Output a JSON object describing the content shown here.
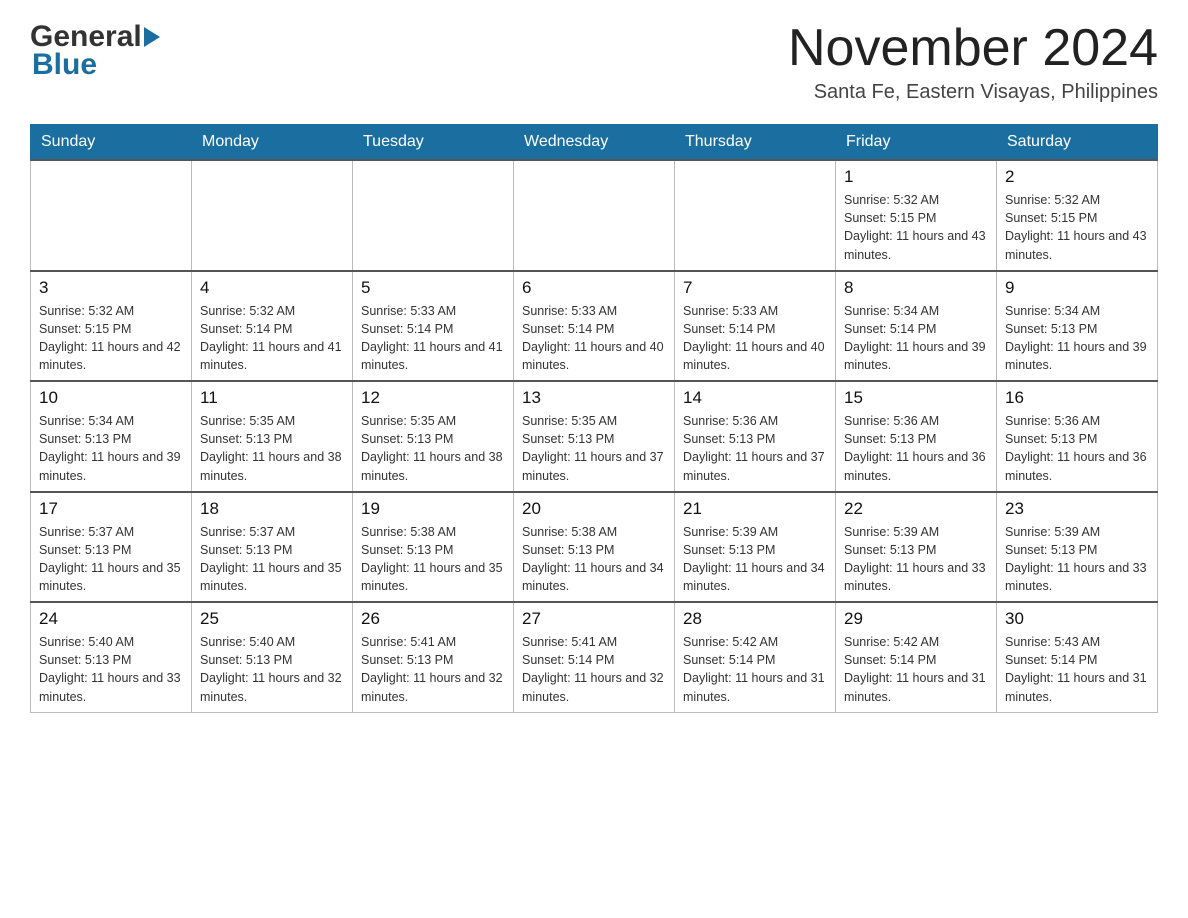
{
  "logo": {
    "general_text": "General",
    "blue_text": "Blue"
  },
  "header": {
    "month_year": "November 2024",
    "location": "Santa Fe, Eastern Visayas, Philippines"
  },
  "weekdays": [
    "Sunday",
    "Monday",
    "Tuesday",
    "Wednesday",
    "Thursday",
    "Friday",
    "Saturday"
  ],
  "weeks": [
    {
      "days": [
        {
          "number": "",
          "info": "",
          "empty": true
        },
        {
          "number": "",
          "info": "",
          "empty": true
        },
        {
          "number": "",
          "info": "",
          "empty": true
        },
        {
          "number": "",
          "info": "",
          "empty": true
        },
        {
          "number": "",
          "info": "",
          "empty": true
        },
        {
          "number": "1",
          "info": "Sunrise: 5:32 AM\nSunset: 5:15 PM\nDaylight: 11 hours and 43 minutes."
        },
        {
          "number": "2",
          "info": "Sunrise: 5:32 AM\nSunset: 5:15 PM\nDaylight: 11 hours and 43 minutes."
        }
      ]
    },
    {
      "days": [
        {
          "number": "3",
          "info": "Sunrise: 5:32 AM\nSunset: 5:15 PM\nDaylight: 11 hours and 42 minutes."
        },
        {
          "number": "4",
          "info": "Sunrise: 5:32 AM\nSunset: 5:14 PM\nDaylight: 11 hours and 41 minutes."
        },
        {
          "number": "5",
          "info": "Sunrise: 5:33 AM\nSunset: 5:14 PM\nDaylight: 11 hours and 41 minutes."
        },
        {
          "number": "6",
          "info": "Sunrise: 5:33 AM\nSunset: 5:14 PM\nDaylight: 11 hours and 40 minutes."
        },
        {
          "number": "7",
          "info": "Sunrise: 5:33 AM\nSunset: 5:14 PM\nDaylight: 11 hours and 40 minutes."
        },
        {
          "number": "8",
          "info": "Sunrise: 5:34 AM\nSunset: 5:14 PM\nDaylight: 11 hours and 39 minutes."
        },
        {
          "number": "9",
          "info": "Sunrise: 5:34 AM\nSunset: 5:13 PM\nDaylight: 11 hours and 39 minutes."
        }
      ]
    },
    {
      "days": [
        {
          "number": "10",
          "info": "Sunrise: 5:34 AM\nSunset: 5:13 PM\nDaylight: 11 hours and 39 minutes."
        },
        {
          "number": "11",
          "info": "Sunrise: 5:35 AM\nSunset: 5:13 PM\nDaylight: 11 hours and 38 minutes."
        },
        {
          "number": "12",
          "info": "Sunrise: 5:35 AM\nSunset: 5:13 PM\nDaylight: 11 hours and 38 minutes."
        },
        {
          "number": "13",
          "info": "Sunrise: 5:35 AM\nSunset: 5:13 PM\nDaylight: 11 hours and 37 minutes."
        },
        {
          "number": "14",
          "info": "Sunrise: 5:36 AM\nSunset: 5:13 PM\nDaylight: 11 hours and 37 minutes."
        },
        {
          "number": "15",
          "info": "Sunrise: 5:36 AM\nSunset: 5:13 PM\nDaylight: 11 hours and 36 minutes."
        },
        {
          "number": "16",
          "info": "Sunrise: 5:36 AM\nSunset: 5:13 PM\nDaylight: 11 hours and 36 minutes."
        }
      ]
    },
    {
      "days": [
        {
          "number": "17",
          "info": "Sunrise: 5:37 AM\nSunset: 5:13 PM\nDaylight: 11 hours and 35 minutes."
        },
        {
          "number": "18",
          "info": "Sunrise: 5:37 AM\nSunset: 5:13 PM\nDaylight: 11 hours and 35 minutes."
        },
        {
          "number": "19",
          "info": "Sunrise: 5:38 AM\nSunset: 5:13 PM\nDaylight: 11 hours and 35 minutes."
        },
        {
          "number": "20",
          "info": "Sunrise: 5:38 AM\nSunset: 5:13 PM\nDaylight: 11 hours and 34 minutes."
        },
        {
          "number": "21",
          "info": "Sunrise: 5:39 AM\nSunset: 5:13 PM\nDaylight: 11 hours and 34 minutes."
        },
        {
          "number": "22",
          "info": "Sunrise: 5:39 AM\nSunset: 5:13 PM\nDaylight: 11 hours and 33 minutes."
        },
        {
          "number": "23",
          "info": "Sunrise: 5:39 AM\nSunset: 5:13 PM\nDaylight: 11 hours and 33 minutes."
        }
      ]
    },
    {
      "days": [
        {
          "number": "24",
          "info": "Sunrise: 5:40 AM\nSunset: 5:13 PM\nDaylight: 11 hours and 33 minutes."
        },
        {
          "number": "25",
          "info": "Sunrise: 5:40 AM\nSunset: 5:13 PM\nDaylight: 11 hours and 32 minutes."
        },
        {
          "number": "26",
          "info": "Sunrise: 5:41 AM\nSunset: 5:13 PM\nDaylight: 11 hours and 32 minutes."
        },
        {
          "number": "27",
          "info": "Sunrise: 5:41 AM\nSunset: 5:14 PM\nDaylight: 11 hours and 32 minutes."
        },
        {
          "number": "28",
          "info": "Sunrise: 5:42 AM\nSunset: 5:14 PM\nDaylight: 11 hours and 31 minutes."
        },
        {
          "number": "29",
          "info": "Sunrise: 5:42 AM\nSunset: 5:14 PM\nDaylight: 11 hours and 31 minutes."
        },
        {
          "number": "30",
          "info": "Sunrise: 5:43 AM\nSunset: 5:14 PM\nDaylight: 11 hours and 31 minutes."
        }
      ]
    }
  ]
}
